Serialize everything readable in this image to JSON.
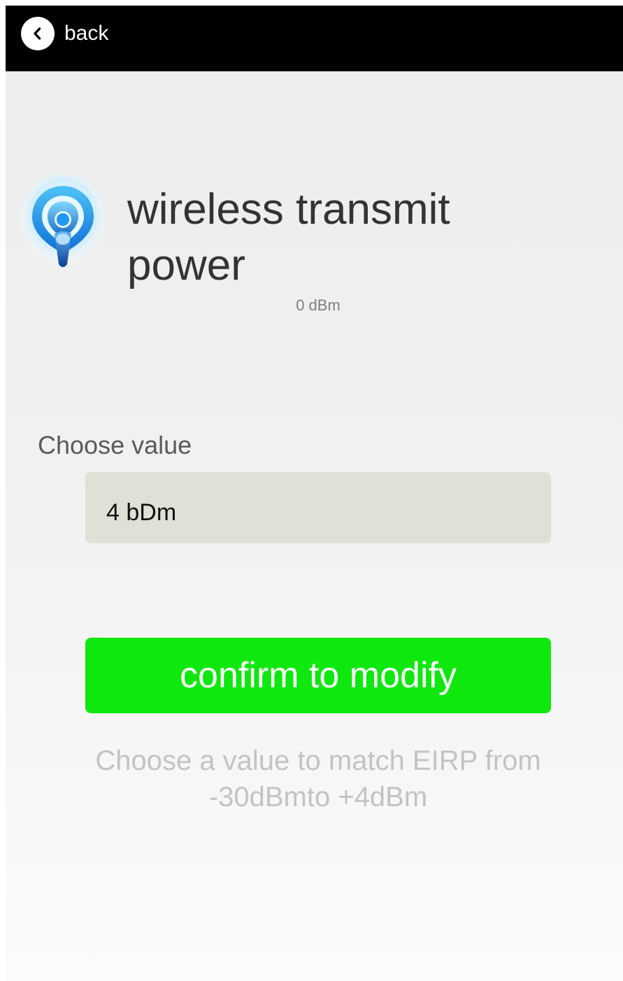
{
  "topbar": {
    "back_label": "back",
    "back_icon": "chevron-left-icon"
  },
  "header": {
    "icon": "wireless-signal-icon",
    "title": "wireless transmit power",
    "current_value": "0 dBm"
  },
  "form": {
    "choose_label": "Choose value",
    "value_input": "4 bDm",
    "confirm_label": "confirm to modify",
    "hint": "Choose a value to match EIRP from -30dBmto +4dBm"
  },
  "colors": {
    "topbar": "#000000",
    "confirm_button": "#0ee80e",
    "input_background": "#e1e0d6",
    "hint_text": "#c3c3c3"
  }
}
